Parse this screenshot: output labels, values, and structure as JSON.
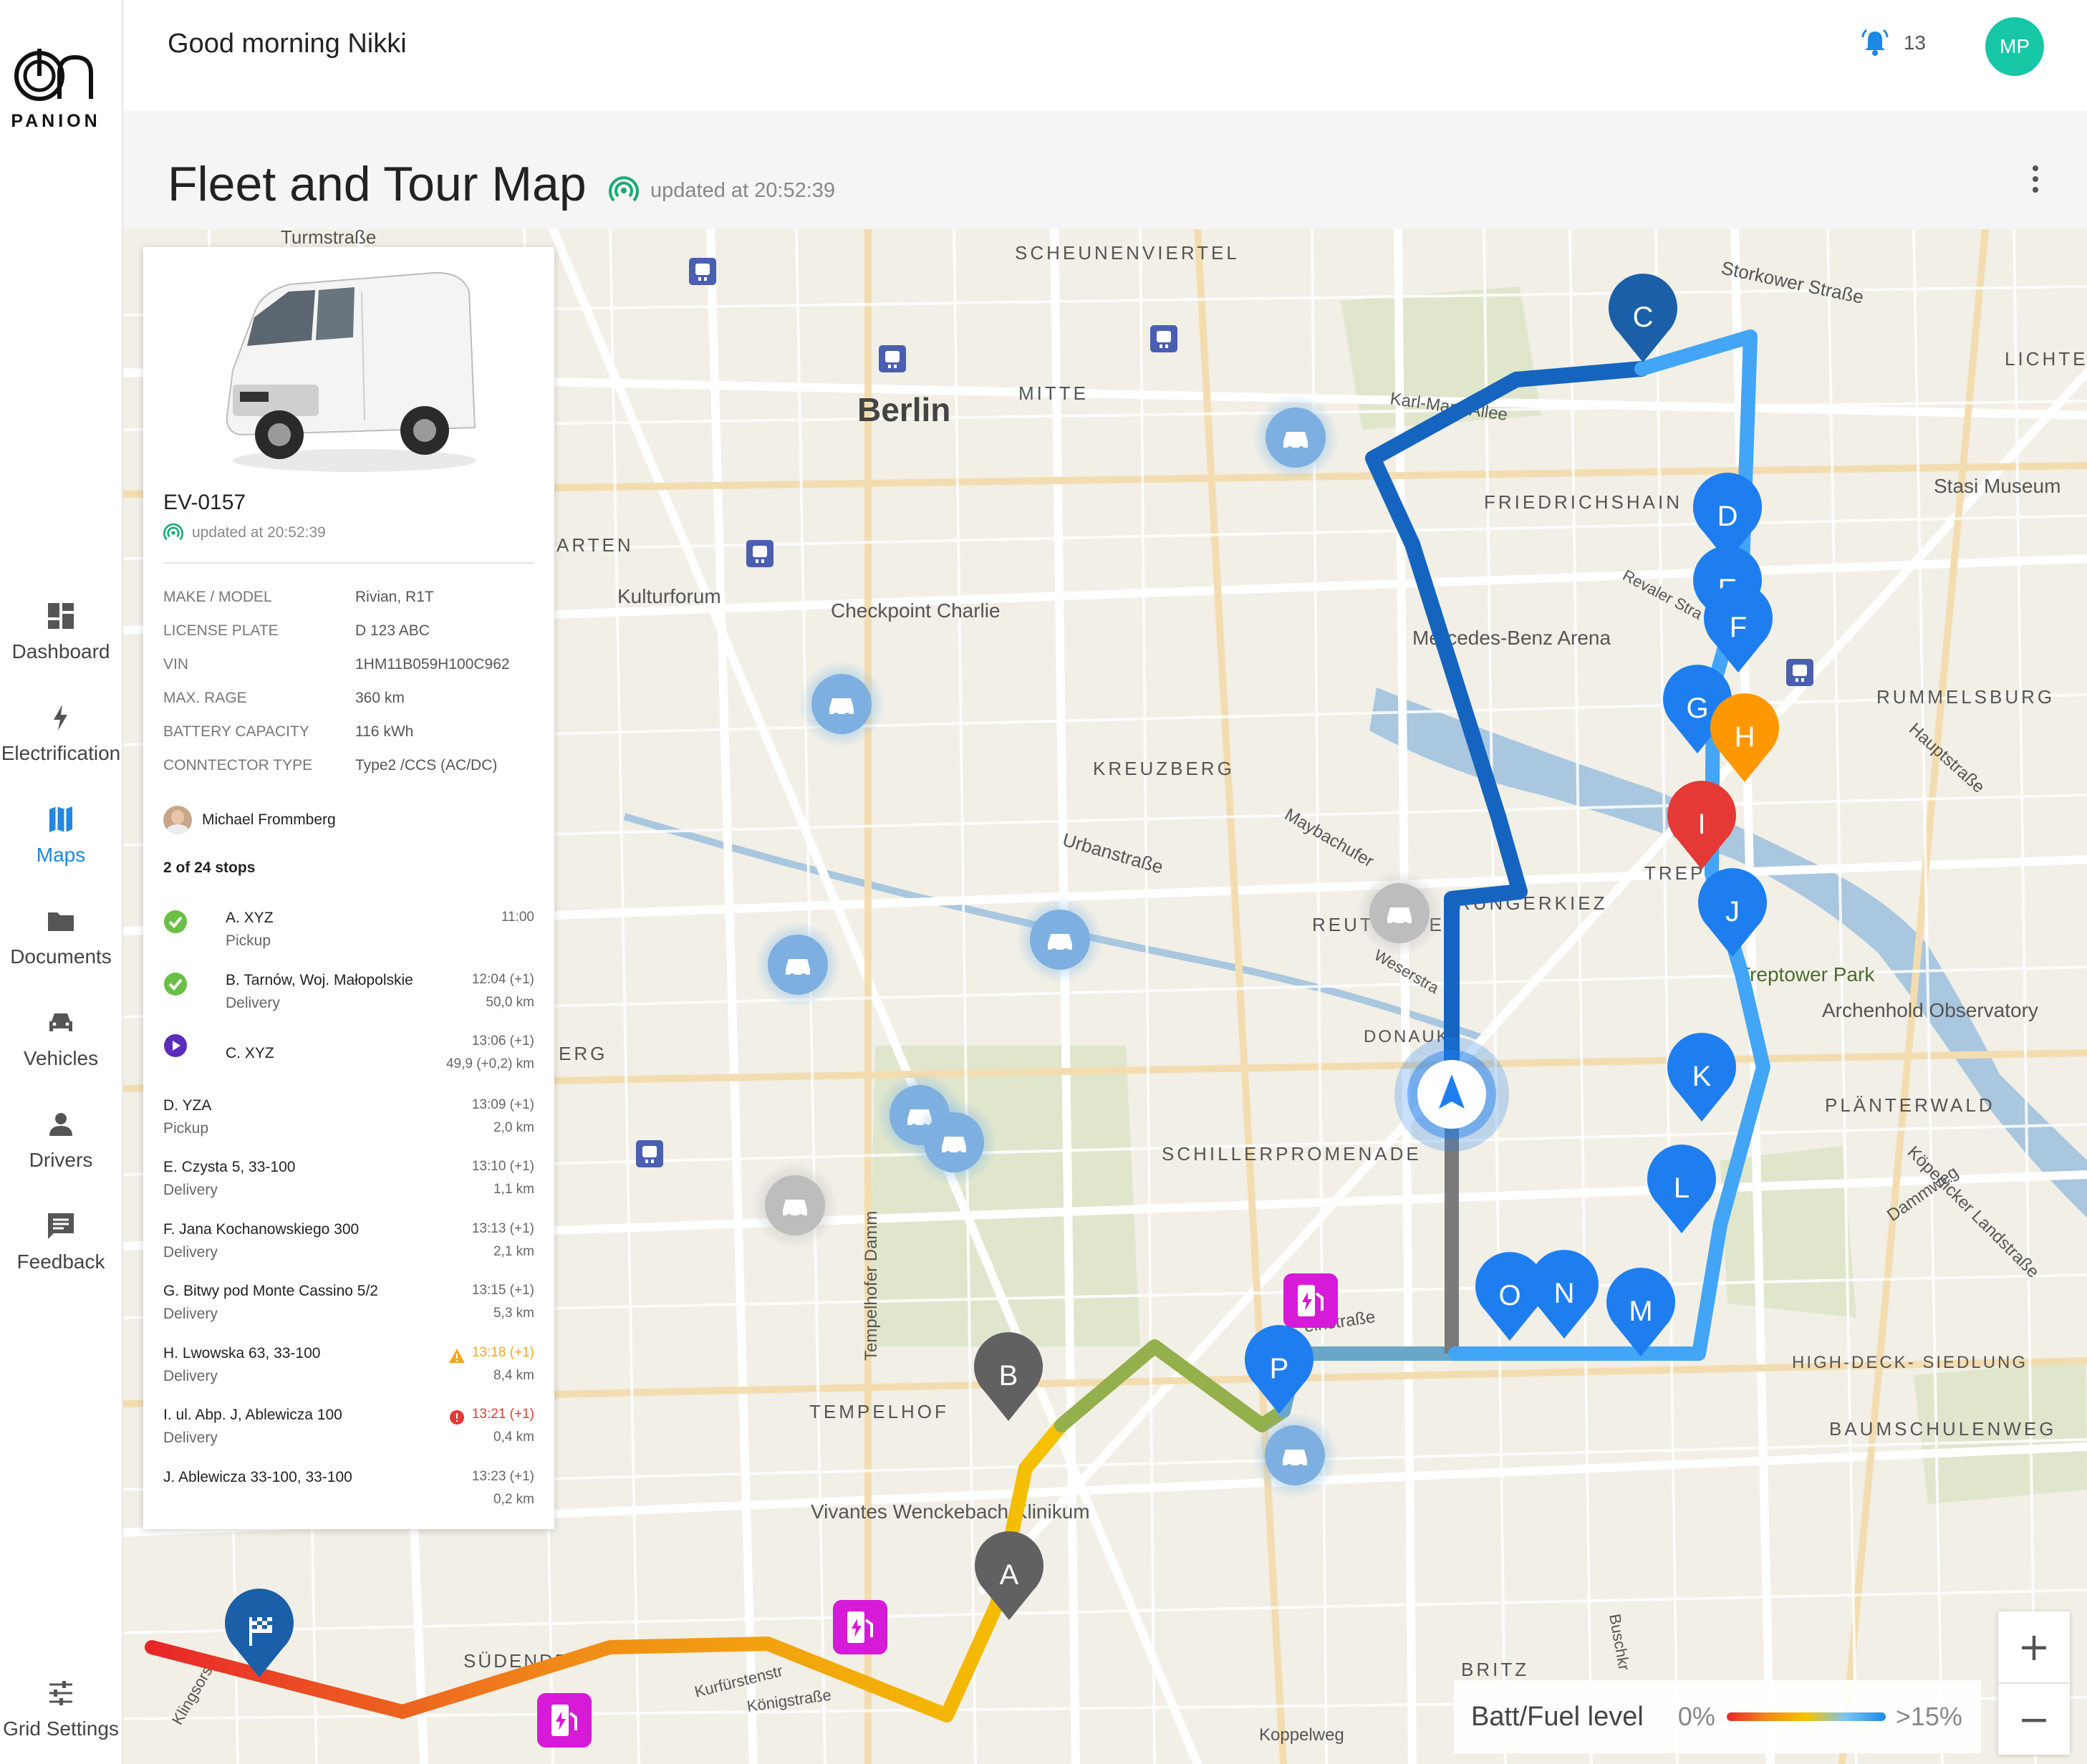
{
  "header": {
    "greeting": "Good morning Nikki",
    "notifications_count": "13",
    "user_initials": "MP"
  },
  "brand": {
    "logo_text": "PANION"
  },
  "sidebar": {
    "items": [
      {
        "label": "Dashboard",
        "icon": "dashboard-icon"
      },
      {
        "label": "Electrification",
        "icon": "bolt-icon"
      },
      {
        "label": "Maps",
        "icon": "map-icon",
        "active": true
      },
      {
        "label": "Documents",
        "icon": "folder-icon"
      },
      {
        "label": "Vehicles",
        "icon": "car-icon"
      },
      {
        "label": "Drivers",
        "icon": "person-icon"
      },
      {
        "label": "Feedback",
        "icon": "feedback-icon"
      }
    ],
    "bottom_item": {
      "label": "Grid Settings",
      "icon": "sliders-icon"
    }
  },
  "page": {
    "title": "Fleet and Tour Map",
    "updated": "updated at 20:52:39"
  },
  "vehicle": {
    "id": "EV-0157",
    "updated": "updated at 20:52:39",
    "specs": [
      {
        "key": "MAKE / MODEL",
        "value": "Rivian, R1T"
      },
      {
        "key": "LICENSE PLATE",
        "value": "D 123 ABC"
      },
      {
        "key": "VIN",
        "value": "1HM11B059H100C962"
      },
      {
        "key": "MAX. RAGE",
        "value": "360 km"
      },
      {
        "key": "BATTERY CAPACITY",
        "value": "116 kWh"
      },
      {
        "key": "CONNTECTOR TYPE",
        "value": "Type2 /CCS (AC/DC)"
      }
    ],
    "driver": "Michael Frommberg",
    "stops_summary": "2 of 24 stops",
    "stops": [
      {
        "name": "A. XYZ",
        "type": "Pickup",
        "time": "11:00",
        "dist": "",
        "status": "done"
      },
      {
        "name": "B. Tarnów, Woj. Małopolskie",
        "type": "Delivery",
        "time": "12:04 (+1)",
        "dist": "50,0 km",
        "status": "done"
      },
      {
        "name": "C. XYZ",
        "type": "",
        "time": "13:06 (+1)",
        "dist": "49,9 (+0,2) km",
        "status": "current"
      },
      {
        "name": "D. YZA",
        "type": "Pickup",
        "time": "13:09 (+1)",
        "dist": "2,0 km",
        "status": ""
      },
      {
        "name": "E. Czysta 5, 33-100",
        "type": "Delivery",
        "time": "13:10 (+1)",
        "dist": "1,1 km",
        "status": ""
      },
      {
        "name": "F. Jana Kochanowskiego 300",
        "type": "Delivery",
        "time": "13:13 (+1)",
        "dist": "2,1 km",
        "status": ""
      },
      {
        "name": "G. Bitwy pod Monte Cassino 5/2",
        "type": "Delivery",
        "time": "13:15 (+1)",
        "dist": "5,3 km",
        "status": ""
      },
      {
        "name": "H. Lwowska 63, 33-100",
        "type": "Delivery",
        "time": "13:18 (+1)",
        "dist": "8,4 km",
        "status": "warning"
      },
      {
        "name": "I. ul. Abp. J, Ablewicza 100",
        "type": "Delivery",
        "time": "13:21 (+1)",
        "dist": "0,4 km",
        "status": "error"
      },
      {
        "name": "J. Ablewicza 33-100, 33-100",
        "type": "",
        "time": "13:23 (+1)",
        "dist": "0,2 km",
        "status": ""
      }
    ]
  },
  "map": {
    "labels": [
      "Berlin",
      "MITTE",
      "SCHEUNENVIERTEL",
      "FRIEDRICHSHAIN",
      "Stasi Museum",
      "LICHTE",
      "Kulturforum",
      "Checkpoint Charlie",
      "KREUZBERG",
      "Urbanstraße",
      "Maybachufer",
      "REUTERKIEZ",
      "RUNGERKIEZ",
      "Weserstra",
      "DONAUK",
      "SCHILLERPROMENADE",
      "RUMMELSBURG",
      "Hauptstraße",
      "TREP",
      "Treptower Park",
      "Archenhold Observatory",
      "PLÄNTERWALD",
      "Dammweg",
      "Köpenicker Landstraße",
      "HIGH-DECK- SIEDLUNG",
      "BAUMSCHULENWEG",
      "TEMPELHOF",
      "Tempelhofer Damm",
      "Vivantes Wenckebach Klinikum",
      "SÜDENDE",
      "Kurfürstenstr",
      "Königstraße",
      "BRITZ",
      "Koppelweg",
      "Buschkr",
      "Storkower Straße",
      "Karl-Marx-Allee",
      "Revaler Stra",
      "Mercedes-Benz Arena",
      "ARTEN",
      "Klingsorstr",
      "einstraße",
      "ERG",
      "Turmstraße"
    ],
    "stop_markers": [
      "A",
      "B",
      "C",
      "D",
      "E",
      "F",
      "G",
      "H",
      "I",
      "J",
      "K",
      "L",
      "M",
      "N",
      "O",
      "P"
    ],
    "colors": {
      "route_dark": "#1565c0",
      "route_light": "#42a5f5",
      "marker_blue": "#1e7ef0",
      "marker_dark": "#1a5fa8",
      "marker_done": "#616161",
      "marker_warning": "#ff9800",
      "marker_error": "#e53935",
      "charger": "#d61ad8",
      "live": "#19a974"
    }
  },
  "legend": {
    "title": "Batt/Fuel level",
    "min": "0%",
    "max": ">15%"
  },
  "zoom": {
    "in": "+",
    "out": "−"
  }
}
